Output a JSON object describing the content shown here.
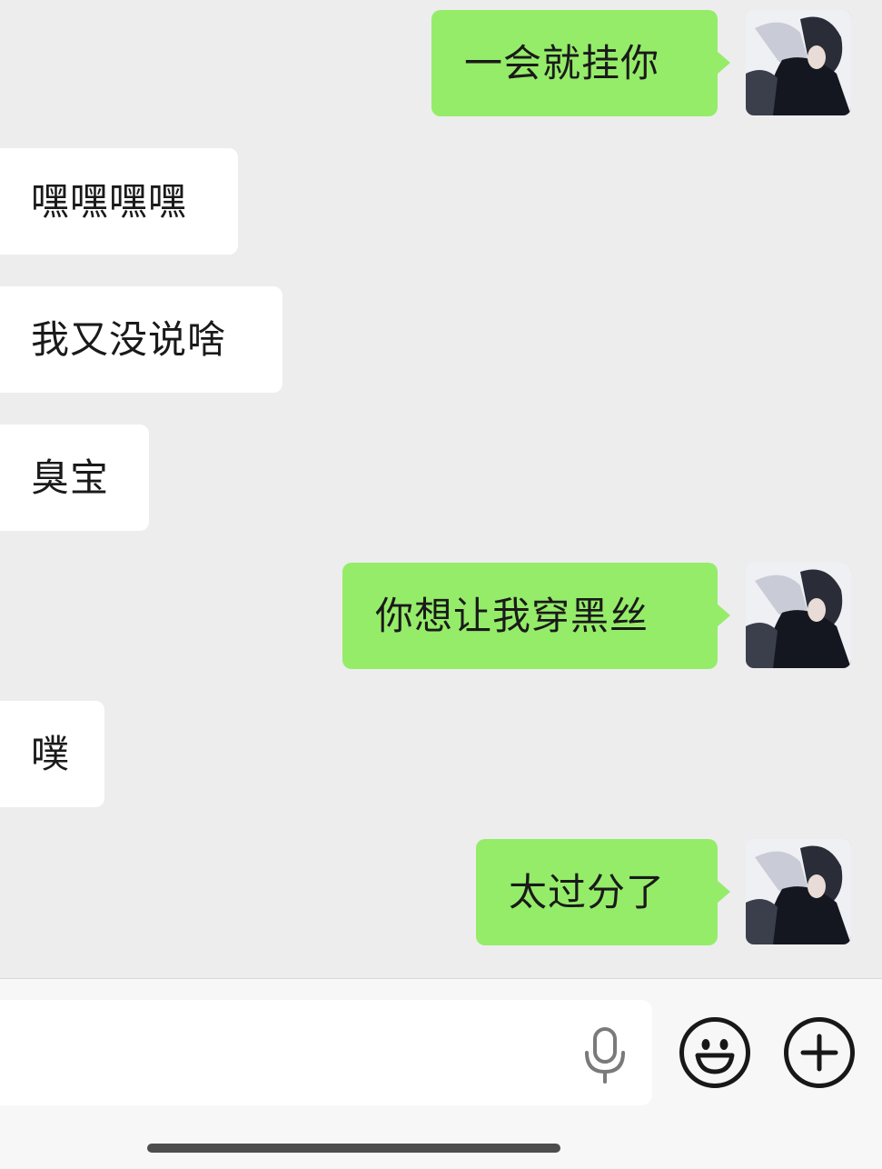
{
  "messages": [
    {
      "side": "sent",
      "text": "一会就挂你"
    },
    {
      "side": "received",
      "text": "嘿嘿嘿嘿"
    },
    {
      "side": "received",
      "text": "我又没说啥"
    },
    {
      "side": "received",
      "text": "臭宝"
    },
    {
      "side": "sent",
      "text": "你想让我穿黑丝"
    },
    {
      "side": "received",
      "text": "噗"
    },
    {
      "side": "sent",
      "text": "太过分了"
    }
  ],
  "input": {
    "value": "",
    "placeholder": ""
  },
  "icons": {
    "voice": "microphone-icon",
    "emoji": "emoji-smile-icon",
    "more": "plus-icon"
  },
  "colors": {
    "sent_bubble": "#95ec69",
    "received_bubble": "#ffffff",
    "chat_background": "#ededed"
  }
}
